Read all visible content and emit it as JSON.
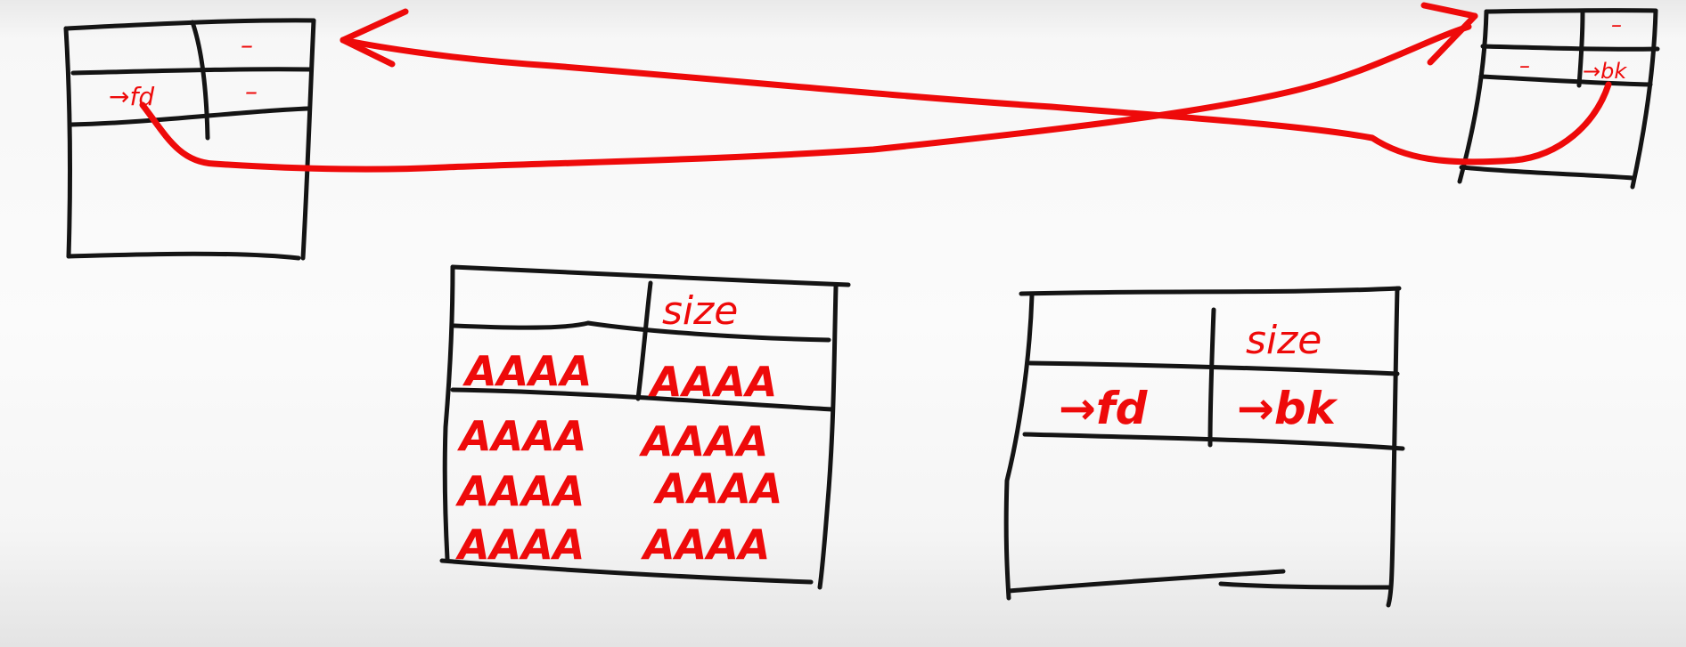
{
  "colors": {
    "ink": "#141414",
    "marker": "#ee0a0a"
  },
  "chunks": {
    "top_left": {
      "fd": "→fd",
      "field_a": "–",
      "field_b": "–"
    },
    "top_right": {
      "bk": "→bk",
      "field_a": "–",
      "field_b": "–"
    },
    "overflow_chunk": {
      "size": "size",
      "rows": [
        [
          "AAAA",
          "AAAA"
        ],
        [
          "AAAA",
          "AAAA"
        ],
        [
          "AAAA",
          "AAAA"
        ],
        [
          "AAAA",
          "AAAA"
        ]
      ]
    },
    "free_chunk": {
      "size": "size",
      "fd": "→fd",
      "bk": "→bk"
    }
  }
}
